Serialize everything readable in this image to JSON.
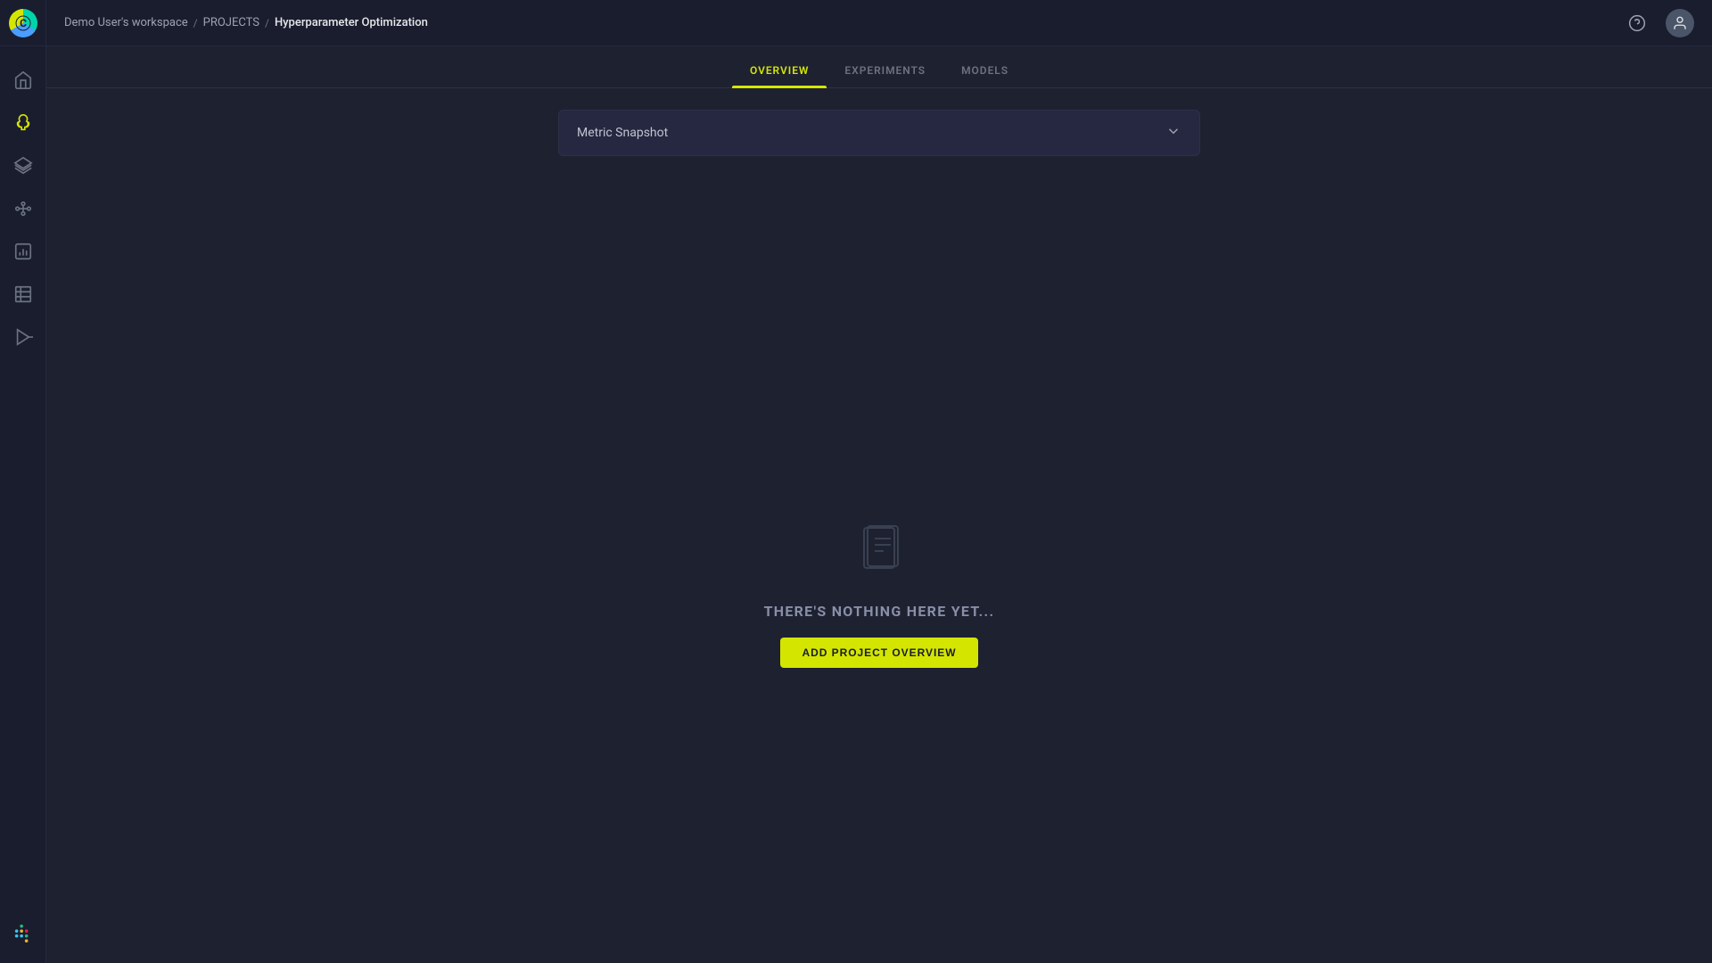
{
  "sidebar": {
    "logo_letter": "C",
    "items": [
      {
        "id": "home",
        "label": "Home",
        "active": false
      },
      {
        "id": "experiments",
        "label": "Experiments",
        "active": true
      },
      {
        "id": "datasets",
        "label": "Datasets",
        "active": false
      },
      {
        "id": "pipelines",
        "label": "Pipelines",
        "active": false
      },
      {
        "id": "reports",
        "label": "Reports",
        "active": false
      },
      {
        "id": "tables",
        "label": "Tables",
        "active": false
      },
      {
        "id": "deploy",
        "label": "Deploy",
        "active": false
      }
    ]
  },
  "topbar": {
    "breadcrumb": {
      "workspace": "Demo User's workspace",
      "projects": "PROJECTS",
      "current": "Hyperparameter Optimization"
    },
    "help_label": "Help",
    "user_label": "User"
  },
  "tabs": [
    {
      "id": "overview",
      "label": "OVERVIEW",
      "active": true
    },
    {
      "id": "experiments",
      "label": "EXPERIMENTS",
      "active": false
    },
    {
      "id": "models",
      "label": "MODELS",
      "active": false
    }
  ],
  "metric_snapshot": {
    "label": "Metric Snapshot"
  },
  "empty_state": {
    "text": "THERE'S NOTHING HERE YET...",
    "button_label": "ADD PROJECT OVERVIEW"
  },
  "colors": {
    "accent": "#d4e600",
    "background": "#1e2130",
    "sidebar_bg": "#1a1d2e",
    "card_bg": "#252840"
  }
}
